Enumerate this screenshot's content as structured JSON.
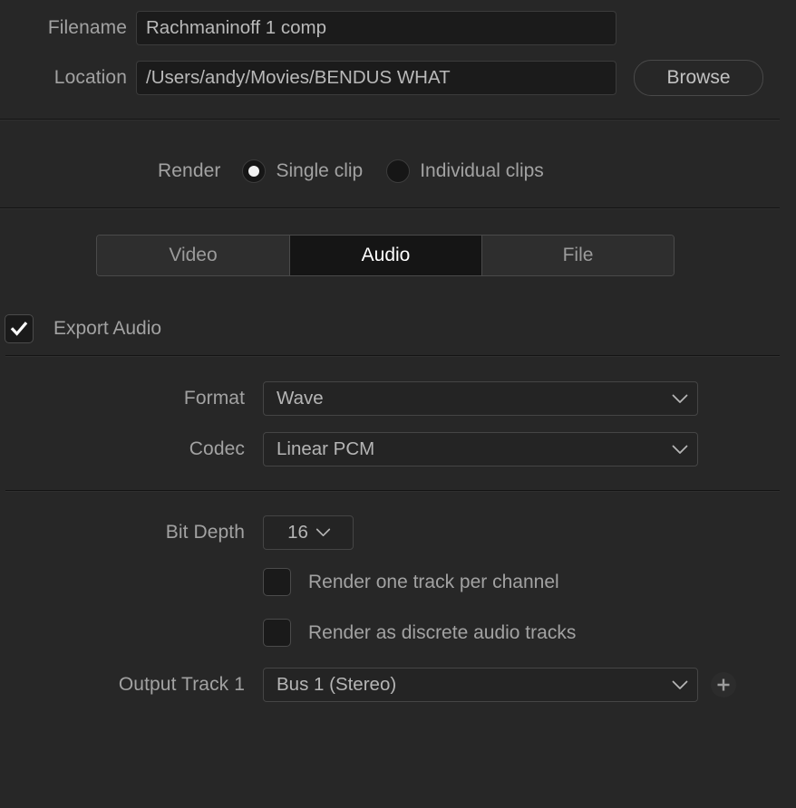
{
  "theme": {
    "background": "#272727",
    "field_bg": "#1b1b1b",
    "text": "#a2a2a2",
    "active_tab_bg": "#151515",
    "accent_white": "#ffffff"
  },
  "file_section": {
    "filename": {
      "label": "Filename",
      "value": "Rachmaninoff 1 comp",
      "placeholder": "Filename"
    },
    "location": {
      "label": "Location",
      "value": "/Users/andy/Movies/BENDUS WHAT",
      "placeholder": "Location"
    },
    "browse_label": "Browse"
  },
  "render_section": {
    "label": "Render",
    "options": [
      {
        "label": "Single clip",
        "selected": true
      },
      {
        "label": "Individual clips",
        "selected": false
      }
    ]
  },
  "tabs": [
    {
      "label": "Video",
      "active": false
    },
    {
      "label": "Audio",
      "active": true
    },
    {
      "label": "File",
      "active": false
    }
  ],
  "export_audio": {
    "label": "Export Audio",
    "checked": true
  },
  "format_section": {
    "format": {
      "label": "Format",
      "value": "Wave"
    },
    "codec": {
      "label": "Codec",
      "value": "Linear PCM"
    }
  },
  "advanced_section": {
    "bit_depth": {
      "label": "Bit Depth",
      "value": "16"
    },
    "one_track_per_channel": {
      "label": "Render one track per channel",
      "checked": false
    },
    "discrete_audio_tracks": {
      "label": "Render as discrete audio tracks",
      "checked": false
    },
    "output_track": {
      "label": "Output Track 1",
      "value": "Bus 1 (Stereo)",
      "add_label": "+"
    }
  }
}
